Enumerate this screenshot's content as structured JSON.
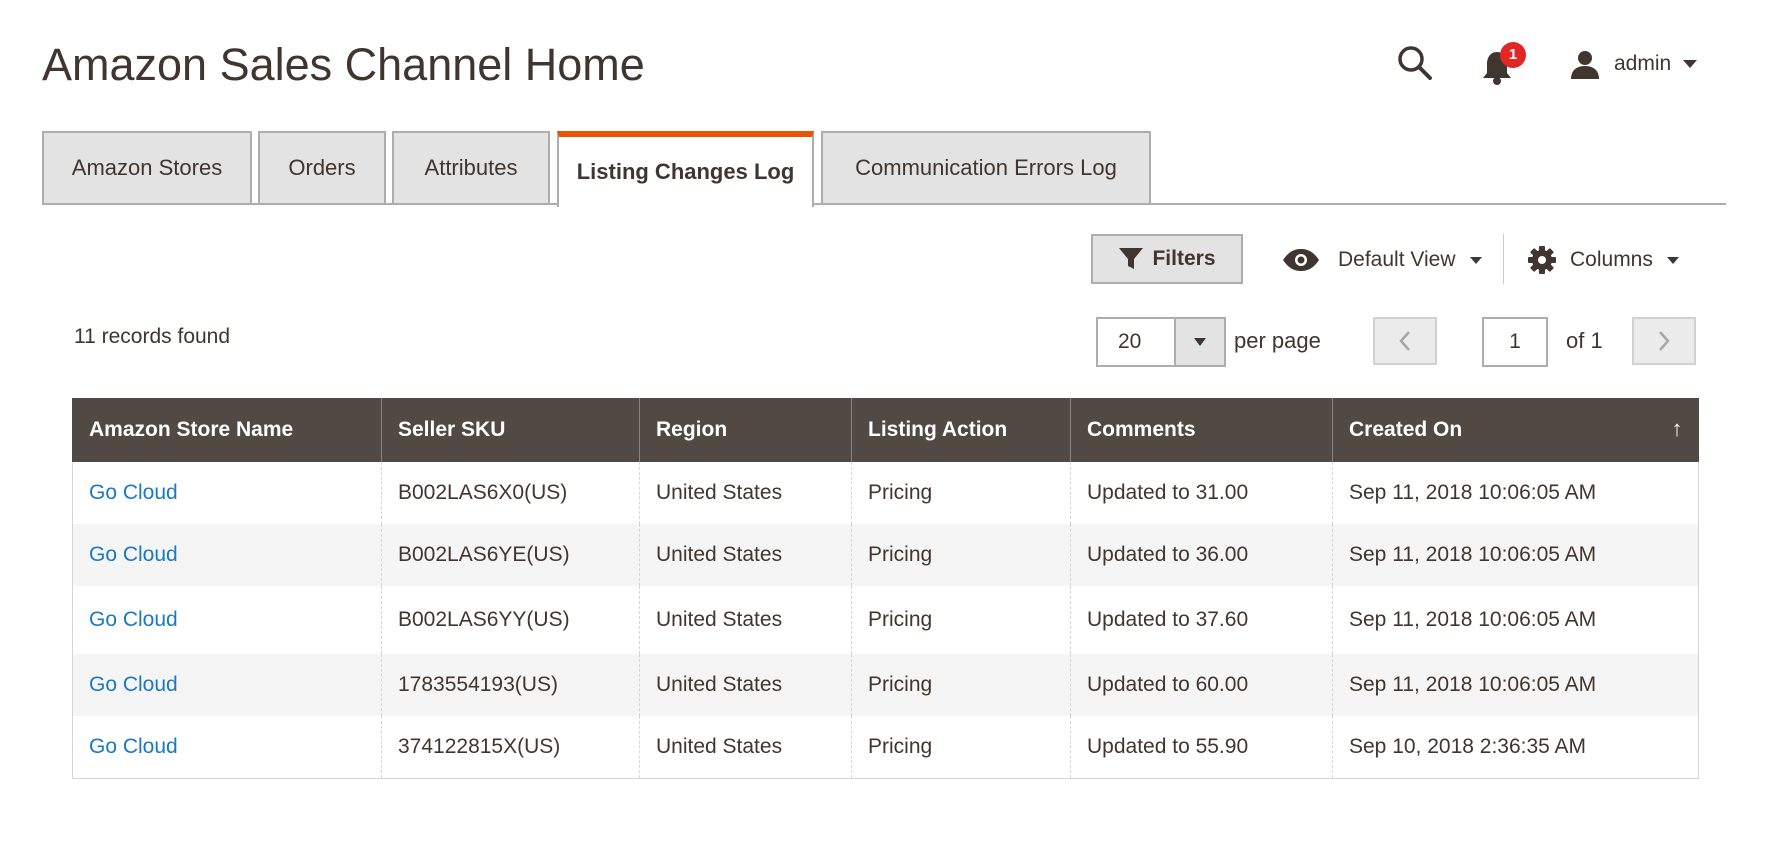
{
  "header": {
    "title": "Amazon Sales Channel Home",
    "notifications_count": "1",
    "user_name": "admin",
    "icons": {
      "search": "search-icon",
      "notifications": "bell-icon",
      "user": "user-icon"
    }
  },
  "tabs": [
    {
      "label": "Amazon Stores",
      "active": false
    },
    {
      "label": "Orders",
      "active": false
    },
    {
      "label": "Attributes",
      "active": false
    },
    {
      "label": "Listing Changes Log",
      "active": true
    },
    {
      "label": "Communication Errors Log",
      "active": false
    }
  ],
  "toolbar": {
    "filters_label": "Filters",
    "view_label": "Default View",
    "columns_label": "Columns"
  },
  "pager": {
    "records_text": "11 records found",
    "per_page_value": "20",
    "per_page_label": "per page",
    "current_page": "1",
    "of_text": "of 1"
  },
  "table": {
    "columns": [
      "Amazon Store Name",
      "Seller SKU",
      "Region",
      "Listing Action",
      "Comments",
      "Created On"
    ],
    "sort_indicator": "↑",
    "rows": [
      [
        "Go Cloud",
        "B002LAS6X0(US)",
        "United States",
        "Pricing",
        "Updated to 31.00",
        "Sep 11, 2018 10:06:05 AM"
      ],
      [
        "Go Cloud",
        "B002LAS6YE(US)",
        "United States",
        "Pricing",
        "Updated to 36.00",
        "Sep 11, 2018 10:06:05 AM"
      ],
      [
        "Go Cloud",
        "B002LAS6YY(US)",
        "United States",
        "Pricing",
        "Updated to 37.60",
        "Sep 11, 2018 10:06:05 AM"
      ],
      [
        "Go Cloud",
        "1783554193(US)",
        "United States",
        "Pricing",
        "Updated to 60.00",
        "Sep 11, 2018 10:06:05 AM"
      ],
      [
        "Go Cloud",
        "374122815X(US)",
        "United States",
        "Pricing",
        "Updated to 55.90",
        "Sep 10, 2018 2:36:35 AM"
      ]
    ]
  },
  "colors": {
    "accent": "#eb5202",
    "header_bg": "#514943",
    "link": "#1979c3",
    "badge": "#e22626"
  }
}
